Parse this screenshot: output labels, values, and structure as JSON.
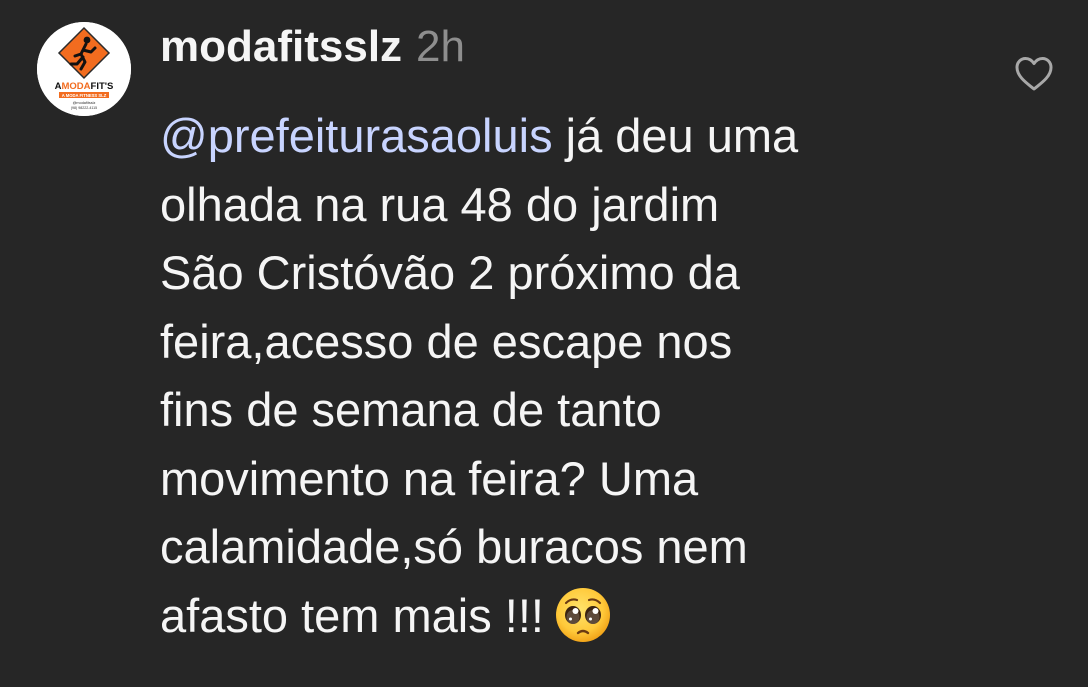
{
  "comment": {
    "username": "modafitsslz",
    "timestamp": "2h",
    "mention": "@prefeiturasaoluis",
    "text_lines": [
      " já deu uma",
      "olhada na rua 48 do jardim",
      "São Cristóvão 2 próximo da",
      "feira,acesso de escape nos",
      "fins de semana de tanto",
      "movimento na feira? Uma",
      "calamidade,só buracos nem",
      "afasto tem mais !!!"
    ],
    "emoji": "pleading-face",
    "like_icon": "heart-outline-icon"
  },
  "avatar": {
    "logo_text": "AMODAFIT'S",
    "logo_subtitle": "A MODA FITNESS SLZ",
    "handle": "@modafitsslz",
    "phone": "(98) 98222-4115",
    "brand_color": "#f26c1f"
  }
}
